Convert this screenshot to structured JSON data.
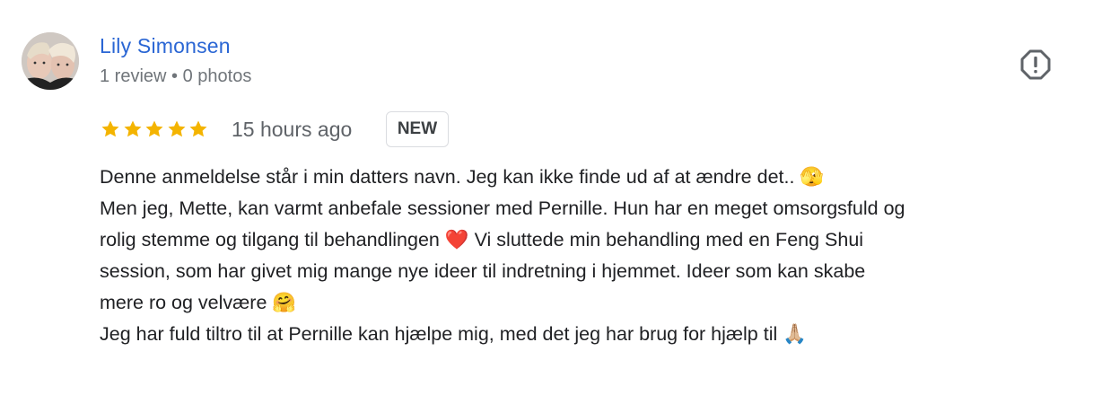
{
  "reviewer": {
    "name": "Lily Simonsen",
    "meta": "1 review • 0 photos"
  },
  "review": {
    "rating": 5,
    "time_ago": "15 hours ago",
    "badge": "NEW",
    "lines": [
      "Denne anmeldelse står i min datters navn. Jeg kan ikke finde ud af at ændre det.. 🫣",
      "Men jeg, Mette, kan varmt anbefale sessioner med Pernille. Hun har en meget omsorgsfuld og",
      "rolig stemme og tilgang til behandlingen ❤️ Vi sluttede min behandling med en Feng Shui",
      "session, som har givet mig mange nye ideer til indretning i hjemmet. Ideer som kan skabe",
      "mere ro og velvære 🤗",
      "Jeg har fuld tiltro til at Pernille kan hjælpe mig, med det jeg har brug for hjælp til 🙏🏼"
    ]
  },
  "colors": {
    "name": "#2a66d4",
    "star": "#f4b400",
    "meta": "#70757a"
  },
  "icons": {
    "report": "report-octagon-icon",
    "star": "star-icon"
  }
}
